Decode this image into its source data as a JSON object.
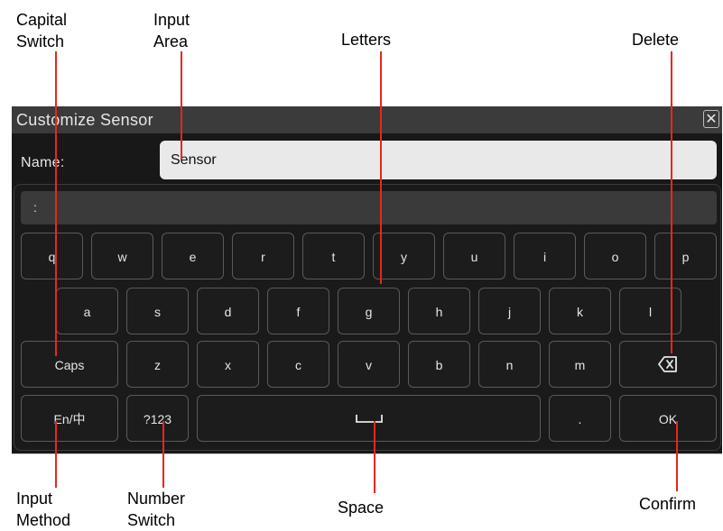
{
  "callouts": {
    "capital_switch": [
      "Capital",
      "Switch"
    ],
    "input_area": [
      "Input",
      "Area"
    ],
    "letters": "Letters",
    "delete": "Delete",
    "input_method": [
      "Input",
      "Method"
    ],
    "number_switch": [
      "Number",
      "Switch"
    ],
    "space": "Space",
    "confirm": "Confirm"
  },
  "dialog": {
    "title": "Customize Sensor",
    "close_glyph": "✕",
    "name_label": "Name:",
    "name_value": "Sensor",
    "candidate_text": ":"
  },
  "keyboard": {
    "row1": [
      "q",
      "w",
      "e",
      "r",
      "t",
      "y",
      "u",
      "i",
      "o",
      "p"
    ],
    "row2": [
      "a",
      "s",
      "d",
      "f",
      "g",
      "h",
      "j",
      "k",
      "l"
    ],
    "row3": [
      "z",
      "x",
      "c",
      "v",
      "b",
      "n",
      "m"
    ],
    "caps_label": "Caps",
    "lang_label": "En/中",
    "num_label": "?123",
    "period_label": ".",
    "ok_label": "OK"
  },
  "icons": {
    "close": "close-icon",
    "delete": "backspace-icon",
    "space": "space-bar-icon"
  },
  "colors": {
    "callout_line": "#e8261d",
    "dialog_bg": "#181818",
    "titlebar_bg": "#3b3b3b",
    "input_bg": "#e9e9e9",
    "key_border": "#5a5a5a"
  }
}
